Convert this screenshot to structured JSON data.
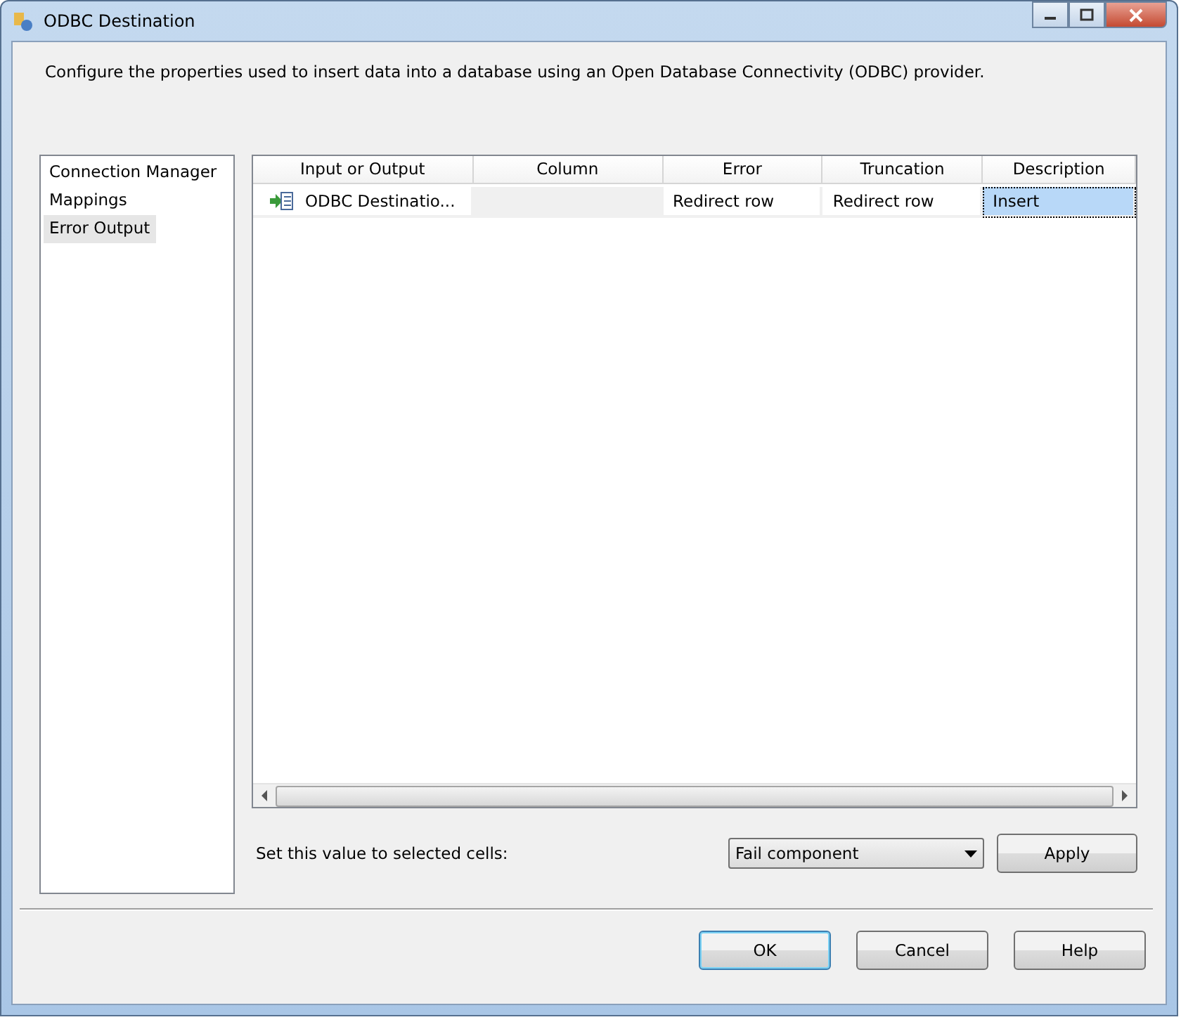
{
  "window": {
    "title": "ODBC Destination"
  },
  "description": "Configure the properties used to insert data into a database using an Open Database Connectivity (ODBC) provider.",
  "sidebar": {
    "items": [
      {
        "label": "Connection Manager",
        "selected": false
      },
      {
        "label": "Mappings",
        "selected": false
      },
      {
        "label": "Error Output",
        "selected": true
      }
    ]
  },
  "table": {
    "columns": [
      "Input or Output",
      "Column",
      "Error",
      "Truncation",
      "Description"
    ],
    "rows": [
      {
        "cells": [
          {
            "text": "ODBC Destinatio...",
            "icon": true,
            "selected": false,
            "disabled": false
          },
          {
            "selected": false,
            "disabled": true
          },
          {
            "text": "Redirect row",
            "selected": false,
            "disabled": false
          },
          {
            "text": "Redirect row",
            "selected": false,
            "disabled": false
          },
          {
            "text": "Insert",
            "selected": true,
            "disabled": false
          }
        ]
      }
    ]
  },
  "set_value": {
    "label": "Set this value to selected cells:",
    "value": "Fail component",
    "button": "Apply"
  },
  "buttons": [
    {
      "label": "OK",
      "default": true
    },
    {
      "label": "Cancel",
      "default": false
    },
    {
      "label": "Help",
      "default": false
    }
  ]
}
